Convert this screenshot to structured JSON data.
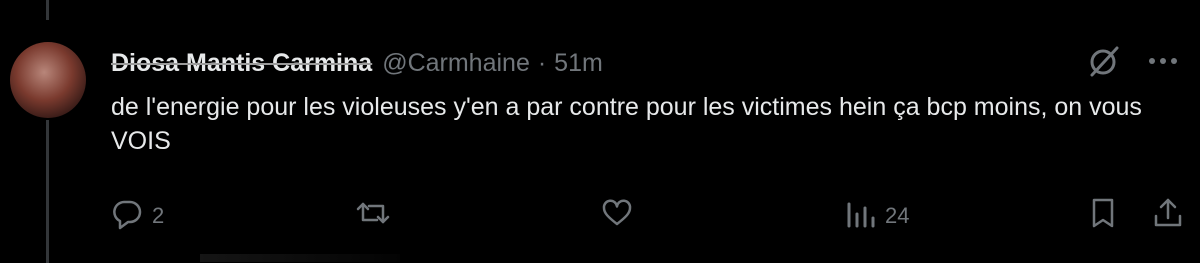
{
  "tweet": {
    "display_name": "Diosa Mantis Carmina",
    "handle": "@Carmhaine",
    "separator": "·",
    "time": "51m",
    "text": "de l'energie pour les violeuses y'en a par contre pour les victimes hein ça bcp moins, on vous VOIS"
  },
  "actions": {
    "reply_count": "2",
    "repost_count": "",
    "like_count": "",
    "views_count": "24"
  },
  "icons": {
    "grok": "grok-icon",
    "more": "more-icon",
    "reply": "reply-icon",
    "repost": "repost-icon",
    "like": "heart-icon",
    "views": "views-icon",
    "bookmark": "bookmark-icon",
    "share": "share-icon"
  },
  "colors": {
    "background": "#000000",
    "text": "#e7e9ea",
    "secondary": "#71767b"
  }
}
